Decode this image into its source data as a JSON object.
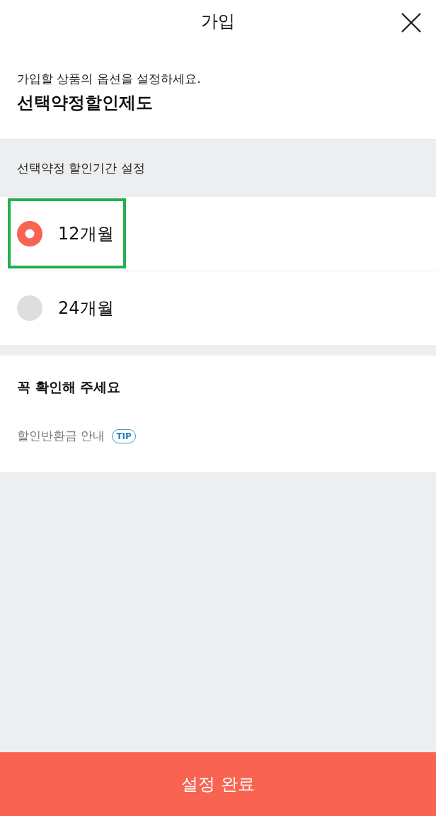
{
  "header": {
    "title": "가입"
  },
  "intro": {
    "subtitle": "가입할 상품의 옵션을 설정하세요.",
    "product": "선택약정할인제도"
  },
  "period_section": {
    "heading": "선택약정 할인기간 설정",
    "options": [
      {
        "label": "12개월",
        "selected": true,
        "highlighted": true
      },
      {
        "label": "24개월",
        "selected": false,
        "highlighted": false
      }
    ]
  },
  "notice": {
    "heading": "꼭 확인해 주세요",
    "items": [
      {
        "label": "할인반환금 안내",
        "badge": "TIP"
      }
    ]
  },
  "confirm_button": "설정 완료"
}
